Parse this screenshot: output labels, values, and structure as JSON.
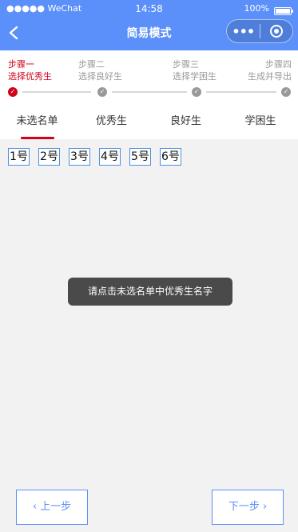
{
  "status_bar": {
    "carrier": "●●●●● WeChat",
    "time": "14:58",
    "battery": "100%"
  },
  "nav": {
    "title": "简易模式",
    "capsule_more": "•••"
  },
  "steps": [
    {
      "title": "步骤一",
      "desc": "选择优秀生",
      "active": true
    },
    {
      "title": "步骤二",
      "desc": "选择良好生",
      "active": false
    },
    {
      "title": "步骤三",
      "desc": "选择学困生",
      "active": false
    },
    {
      "title": "步骤四",
      "desc": "生成并导出",
      "active": false
    }
  ],
  "tabs": [
    {
      "label": "未选名单",
      "active": true
    },
    {
      "label": "优秀生",
      "active": false
    },
    {
      "label": "良好生",
      "active": false
    },
    {
      "label": "学困生",
      "active": false
    }
  ],
  "students": [
    "1号",
    "2号",
    "3号",
    "4号",
    "5号",
    "6号"
  ],
  "toast": "请点击未选名单中优秀生名字",
  "buttons": {
    "prev": "上一步",
    "next": "下一步"
  },
  "colors": {
    "header": "#5b8ff9",
    "accent": "#d0021b",
    "chip_border": "#4a90e2"
  }
}
